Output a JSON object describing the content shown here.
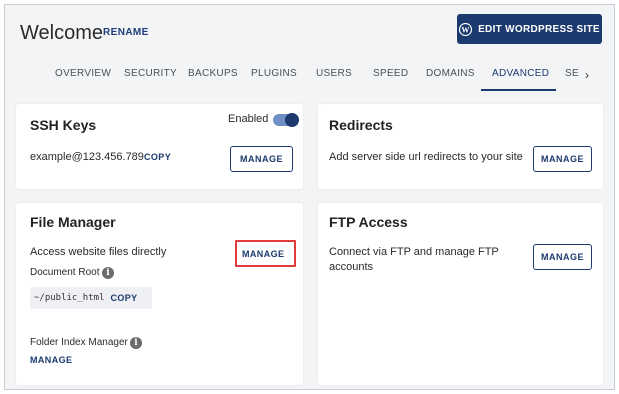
{
  "header": {
    "title": "Welcome",
    "rename_label": "RENAME",
    "wp_button_label": "EDIT WORDPRESS SITE",
    "wp_icon": "wordpress-icon"
  },
  "tabs": [
    {
      "label": "OVERVIEW"
    },
    {
      "label": "SECURITY"
    },
    {
      "label": "BACKUPS"
    },
    {
      "label": "PLUGINS"
    },
    {
      "label": "USERS"
    },
    {
      "label": "SPEED"
    },
    {
      "label": "DOMAINS"
    },
    {
      "label": "ADVANCED",
      "active": true
    },
    {
      "label": "SE"
    }
  ],
  "tabs_more_icon": "chevron-right-icon",
  "ssh": {
    "title": "SSH Keys",
    "toggle_label": "Enabled",
    "toggle_on": true,
    "account": "example@123.456.789",
    "copy_label": "COPY",
    "manage_label": "MANAGE"
  },
  "redirects": {
    "title": "Redirects",
    "description": "Add server side url redirects to your site",
    "manage_label": "MANAGE"
  },
  "file_manager": {
    "title": "File Manager",
    "description": "Access website files directly",
    "manage_label": "MANAGE",
    "doc_root_label": "Document Root",
    "doc_root_value": "~/public_html",
    "copy_label": "COPY",
    "folder_index_label": "Folder Index Manager",
    "folder_index_link": "MANAGE"
  },
  "ftp": {
    "title": "FTP Access",
    "description_line1": "Connect via FTP and manage FTP",
    "description_line2": "accounts",
    "manage_label": "MANAGE"
  },
  "colors": {
    "brand": "#1c3a6e",
    "highlight": "#e03b3b",
    "background": "#f3f4f6"
  }
}
